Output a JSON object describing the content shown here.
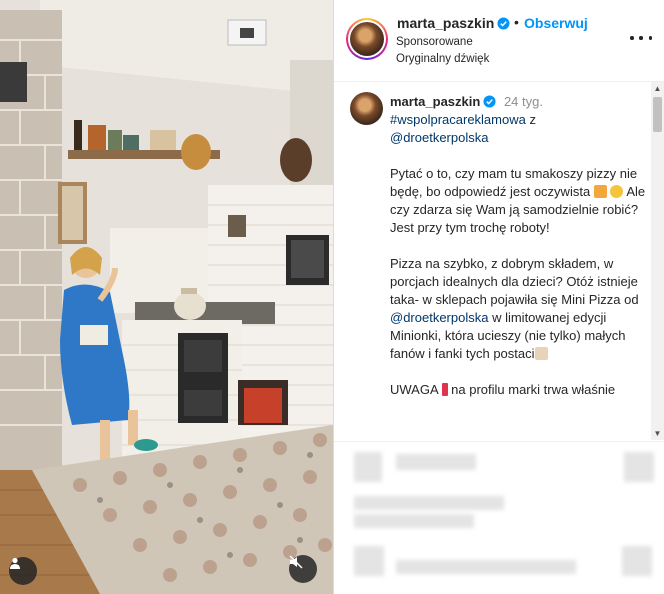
{
  "post": {
    "username": "marta_paszkin",
    "follow_label": "Obserwuj",
    "sponsored_label": "Sponsorowane",
    "audio_label": "Oryginalny dźwięk"
  },
  "caption": {
    "username": "marta_paszkin",
    "time": "24 tyg.",
    "hashtag": "#wspolpracareklamowa",
    "line1_tail": " z",
    "mention": "@droetkerpolska",
    "p1_a": "Pytać o to, czy mam tu smakoszy pizzy nie będę, bo odpowiedź jest oczywista ",
    "p1_b": " Ale czy zdarza się Wam ją samodzielnie robić? Jest przy tym trochę roboty!",
    "p2_a": "Pizza na szybko, z dobrym składem, w porcjach idealnych dla dzieci? Otóż istnieje taka- w sklepach pojawiła się Mini Pizza od ",
    "p2_mention": "@droetkerpolska",
    "p2_b": " w limitowanej edycji Minionki, która ucieszy (nie tylko) małych fanów i fanki tych postaci",
    "p3_a": "UWAGA",
    "p3_b": " na profilu marki trwa właśnie"
  },
  "icons": {
    "verified": "verified-badge-icon",
    "more": "more-options-icon",
    "user_tag": "user-tag-icon",
    "mute": "speaker-muted-icon"
  },
  "colors": {
    "accent": "#0095f6",
    "link": "#00376b",
    "muted": "#8e8e8e"
  }
}
